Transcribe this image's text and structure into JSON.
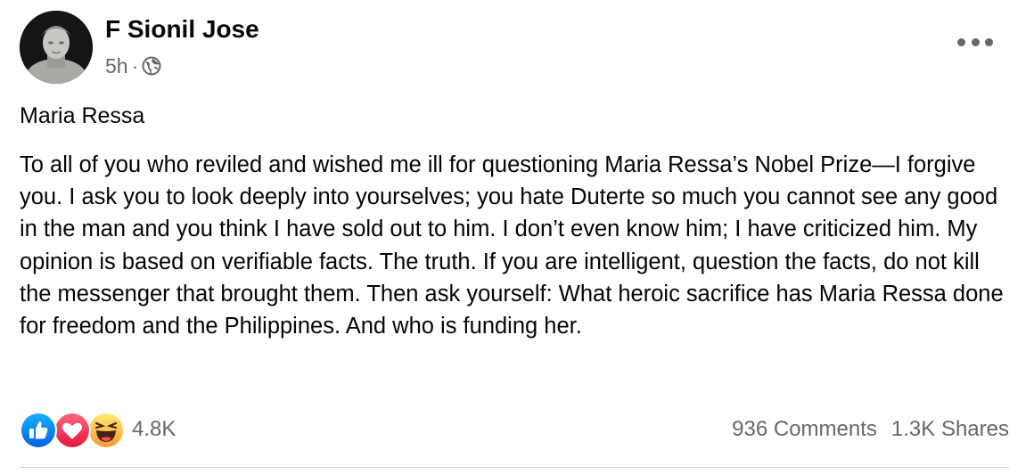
{
  "post": {
    "author": "F Sionil Jose",
    "time": "5h",
    "separator": "·",
    "audience_icon": "globe-icon",
    "title": "Maria Ressa",
    "body": "To all of you who reviled and wished me ill for questioning Maria Ressa’s Nobel Prize—I forgive you. I ask you to look deeply into yourselves; you hate Duterte so much you cannot see any good in the man and you think I have sold out to him. I don’t even know him; I have criticized him. My opinion is based on verifiable facts. The truth. If you are intelligent, question the facts, do not kill the messenger that brought them. Then ask yourself: What heroic sacrifice has Maria Ressa done for freedom and the Philippines. And who is funding her."
  },
  "reactions": {
    "icons": [
      "like-icon",
      "love-icon",
      "haha-icon"
    ],
    "count": "4.8K"
  },
  "stats": {
    "comments": "936 Comments",
    "shares": "1.3K Shares"
  },
  "colors": {
    "secondary_text": "#65676b",
    "like_blue": "#1877f2",
    "love_red": "#f33e58",
    "haha_yellow": "#f7b125",
    "divider": "#ced0d4"
  }
}
